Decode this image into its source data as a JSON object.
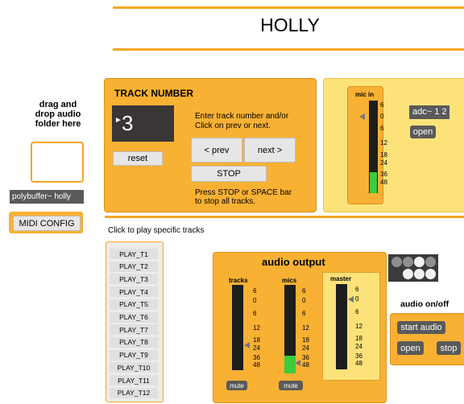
{
  "title": "HOLLY",
  "drop_label": "drag and\ndrop audio\nfolder here",
  "polybuffer_label": "polybuffer~ holly",
  "midi_config_label": "MIDI CONFIG",
  "track_panel": {
    "heading": "TRACK NUMBER",
    "number": "3",
    "reset_label": "reset",
    "instructions": "Enter track number and/or\nClick on prev or next.",
    "prev_label": "< prev",
    "next_label": "next >",
    "stop_label": "STOP",
    "stop_help": "Press STOP or SPACE bar\nto stop all tracks."
  },
  "mic_panel": {
    "meter_label": "mic in",
    "adc_label": "adc~ 1 2",
    "open_label": "open"
  },
  "click_to_play": "Click to play specific tracks",
  "play_buttons": [
    "PLAY_T1",
    "PLAY_T2",
    "PLAY_T3",
    "PLAY_T4",
    "PLAY_T5",
    "PLAY_T6",
    "PLAY_T7",
    "PLAY_T8",
    "PLAY_T9",
    "PLAY_T10",
    "PLAY_T11",
    "PLAY_T12"
  ],
  "audio_output": {
    "heading": "audio output",
    "tracks_label": "tracks",
    "mics_label": "mics",
    "master_label": "master",
    "mute_label": "mute",
    "scale": [
      "6",
      "0",
      "6",
      "12",
      "18",
      "24",
      "36",
      "48"
    ]
  },
  "audio_onoff": {
    "heading": "audio on/off",
    "start_label": "start audio",
    "open_label": "open",
    "stop_label": "stop"
  },
  "colors": {
    "accent": "#f8b133",
    "light_panel": "#fde27a",
    "meter_green": "#3ccc3c"
  }
}
